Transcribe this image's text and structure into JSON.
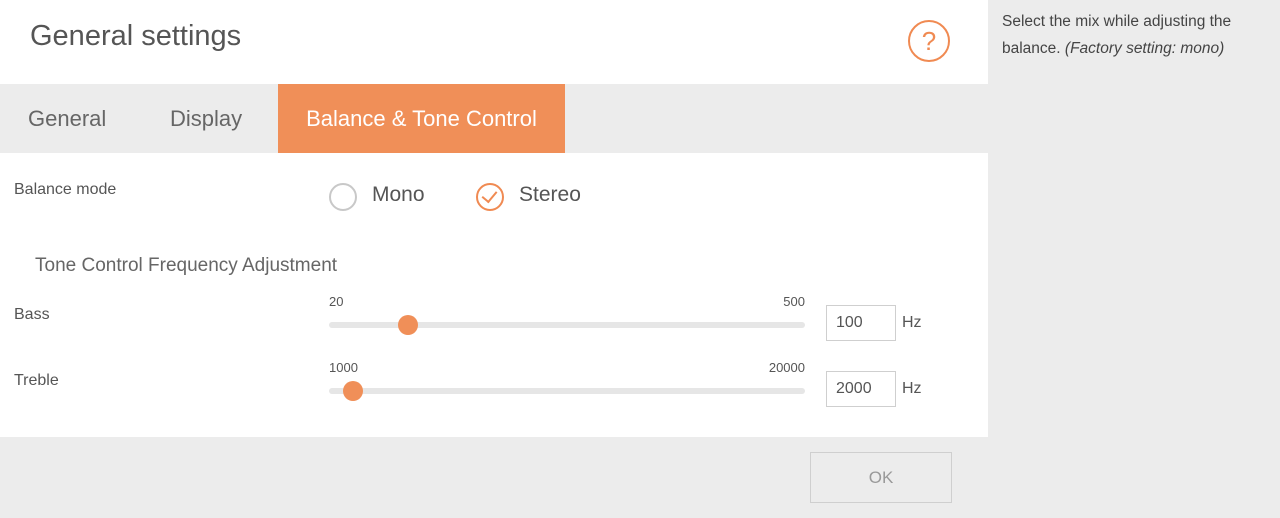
{
  "header": {
    "title": "General settings",
    "help_icon": "question-mark-circle-icon"
  },
  "tabs": [
    {
      "label": "General",
      "active": false
    },
    {
      "label": "Display",
      "active": false
    },
    {
      "label": "Balance & Tone Control",
      "active": true
    }
  ],
  "balance": {
    "label": "Balance mode",
    "options": [
      {
        "label": "Mono",
        "selected": false
      },
      {
        "label": "Stereo",
        "selected": true
      }
    ]
  },
  "tone": {
    "heading": "Tone Control Frequency Adjustment",
    "bass": {
      "label": "Bass",
      "min": "20",
      "max": "500",
      "value": "100",
      "unit": "Hz",
      "slider_fraction": 0.166
    },
    "treble": {
      "label": "Treble",
      "min": "1000",
      "max": "20000",
      "value": "2000",
      "unit": "Hz",
      "slider_fraction": 0.05
    }
  },
  "footer": {
    "ok_label": "OK"
  },
  "help_pane": {
    "text": "Select the mix while adjusting the balance.",
    "italic_note": "(Factory setting: mono)"
  },
  "colors": {
    "accent": "#f08f58",
    "background": "#ececec",
    "panel": "#ffffff"
  }
}
